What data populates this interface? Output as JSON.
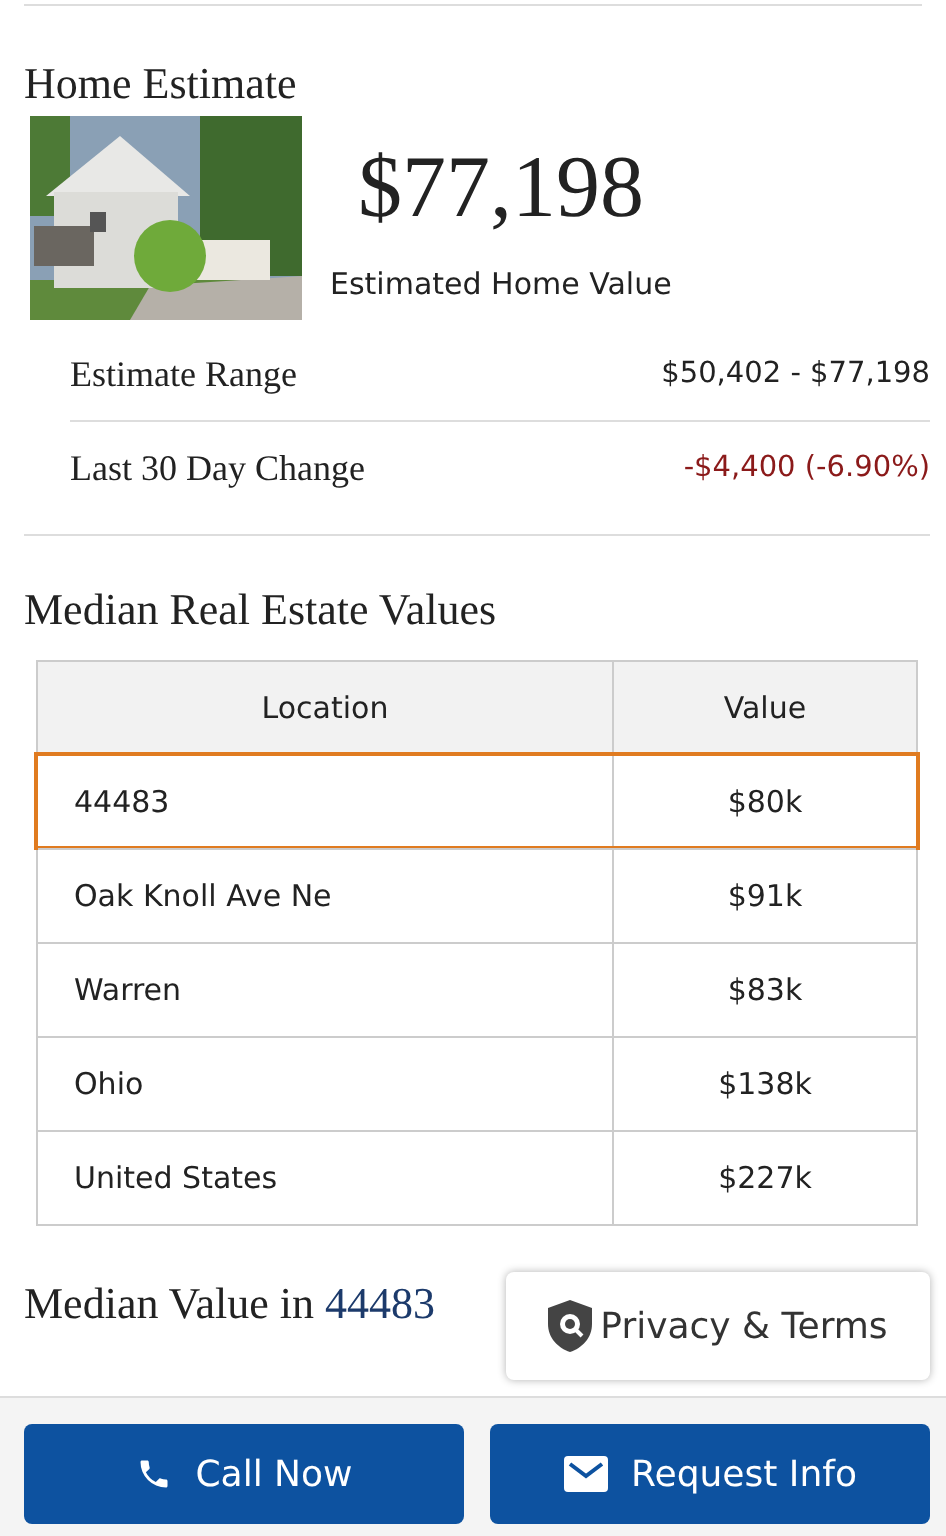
{
  "estimate": {
    "heading": "Home Estimate",
    "price": "$77,198",
    "price_caption": "Estimated Home Value",
    "rows": [
      {
        "label": "Estimate Range",
        "value": "$50,402 - $77,198",
        "negative": false
      },
      {
        "label": "Last 30 Day Change",
        "value": "-$4,400 (-6.90%)",
        "negative": true
      }
    ]
  },
  "median_table": {
    "heading": "Median Real Estate Values",
    "columns": [
      "Location",
      "Value"
    ],
    "rows": [
      {
        "location": "44483",
        "value": "$80k",
        "selected": true
      },
      {
        "location": "Oak Knoll Ave Ne",
        "value": "$91k",
        "selected": false
      },
      {
        "location": "Warren",
        "value": "$83k",
        "selected": false
      },
      {
        "location": "Ohio",
        "value": "$138k",
        "selected": false
      },
      {
        "location": "United States",
        "value": "$227k",
        "selected": false
      }
    ]
  },
  "median_value": {
    "heading": "Median Value in",
    "zip": "44483"
  },
  "privacy_badge": {
    "label": "Privacy & Terms"
  },
  "actions": [
    {
      "kind": "call",
      "label": "Call Now"
    },
    {
      "kind": "mail",
      "label": "Request Info"
    }
  ]
}
